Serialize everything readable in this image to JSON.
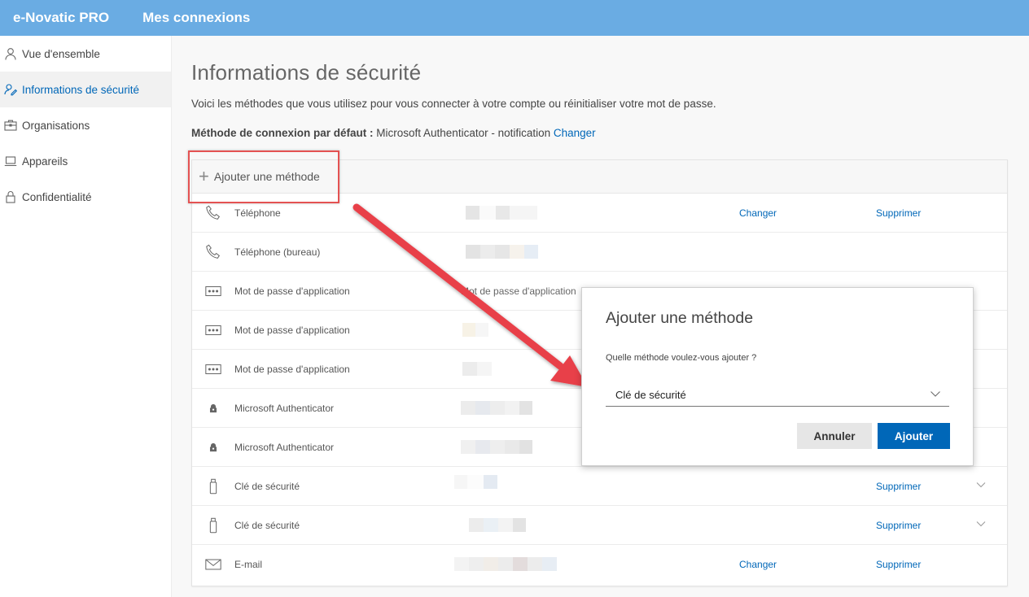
{
  "header": {
    "brand": "e-Novatic PRO",
    "app_title": "Mes connexions"
  },
  "sidebar": {
    "items": [
      {
        "label": "Vue d'ensemble",
        "icon": "person-icon"
      },
      {
        "label": "Informations de sécurité",
        "icon": "security-info-icon",
        "active": true
      },
      {
        "label": "Organisations",
        "icon": "briefcase-icon"
      },
      {
        "label": "Appareils",
        "icon": "laptop-icon"
      },
      {
        "label": "Confidentialité",
        "icon": "lock-icon"
      }
    ]
  },
  "main": {
    "title": "Informations de sécurité",
    "subtitle": "Voici les méthodes que vous utilisez pour vous connecter à votre compte ou réinitialiser votre mot de passe.",
    "default_label": "Méthode de connexion par défaut :",
    "default_value": " Microsoft Authenticator - notification ",
    "default_change": "Changer",
    "add_method": "Ajouter une méthode",
    "methods": [
      {
        "label": "Téléphone",
        "icon": "phone-icon",
        "change": "Changer",
        "delete": "Supprimer"
      },
      {
        "label": "Téléphone (bureau)",
        "icon": "phone-icon"
      },
      {
        "label": "Mot de passe d'application",
        "icon": "app-password-icon",
        "value": "Mot de passe d'application"
      },
      {
        "label": "Mot de passe d'application",
        "icon": "app-password-icon"
      },
      {
        "label": "Mot de passe d'application",
        "icon": "app-password-icon"
      },
      {
        "label": "Microsoft Authenticator",
        "icon": "authenticator-icon"
      },
      {
        "label": "Microsoft Authenticator",
        "icon": "authenticator-icon"
      },
      {
        "label": "Clé de sécurité",
        "icon": "usb-key-icon",
        "delete": "Supprimer",
        "expandable": true
      },
      {
        "label": "Clé de sécurité",
        "icon": "usb-key-icon",
        "delete": "Supprimer",
        "expandable": true
      },
      {
        "label": "E-mail",
        "icon": "mail-icon",
        "change": "Changer",
        "delete": "Supprimer"
      }
    ]
  },
  "modal": {
    "title": "Ajouter une méthode",
    "question": "Quelle méthode voulez-vous ajouter ?",
    "selected": "Clé de sécurité",
    "cancel": "Annuler",
    "add": "Ajouter"
  },
  "colors": {
    "header_bg": "#6aace3",
    "accent": "#0067b8",
    "highlight": "#e45252"
  }
}
